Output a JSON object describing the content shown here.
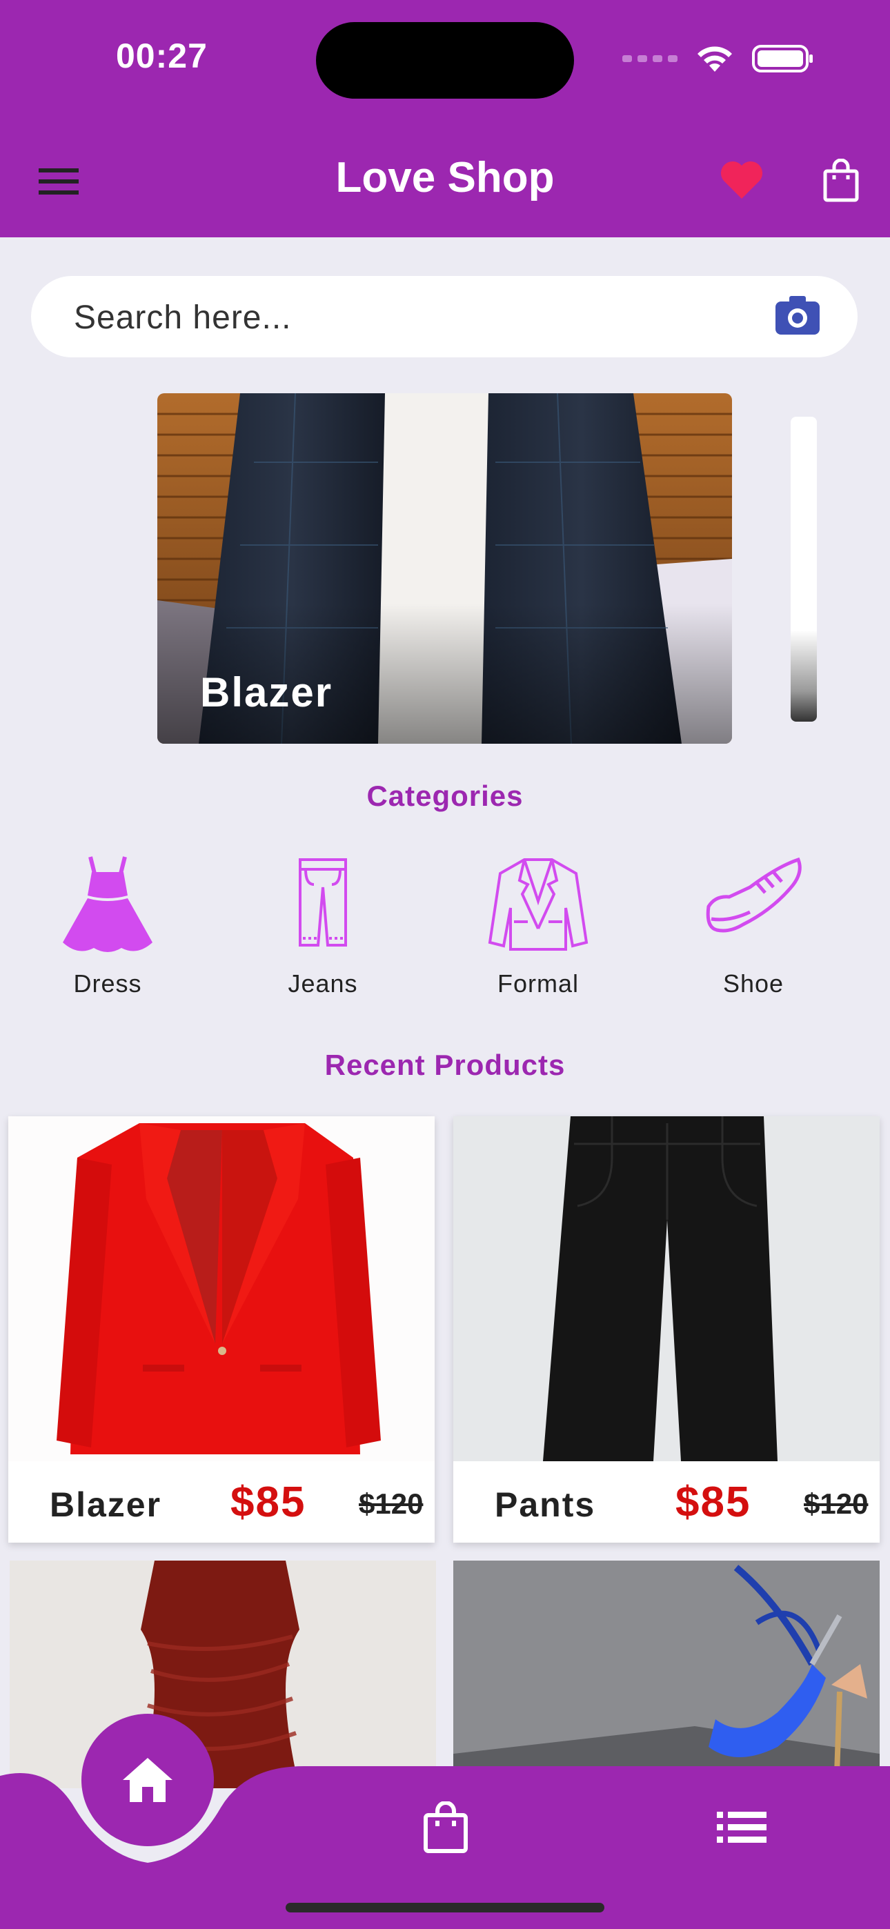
{
  "status_bar": {
    "time": "00:27"
  },
  "header": {
    "title": "Love Shop"
  },
  "search": {
    "placeholder": "Search here..."
  },
  "banner": {
    "label": "Blazer"
  },
  "categories": {
    "title": "Categories",
    "items": [
      {
        "label": "Dress",
        "icon": "dress-icon"
      },
      {
        "label": "Jeans",
        "icon": "jeans-icon"
      },
      {
        "label": "Formal",
        "icon": "formal-icon"
      },
      {
        "label": "Shoe",
        "icon": "shoe-icon"
      }
    ]
  },
  "recent": {
    "title": "Recent Products",
    "products": [
      {
        "name": "Blazer",
        "price": "$85",
        "old_price": "$120"
      },
      {
        "name": "Pants",
        "price": "$85",
        "old_price": "$120"
      }
    ]
  },
  "colors": {
    "primary": "#9C27B0",
    "accent": "#F0245A",
    "price": "#D40F0F",
    "background": "#ECEBF3"
  },
  "nav": {
    "items": [
      "home-icon",
      "bag-icon",
      "list-icon"
    ]
  }
}
